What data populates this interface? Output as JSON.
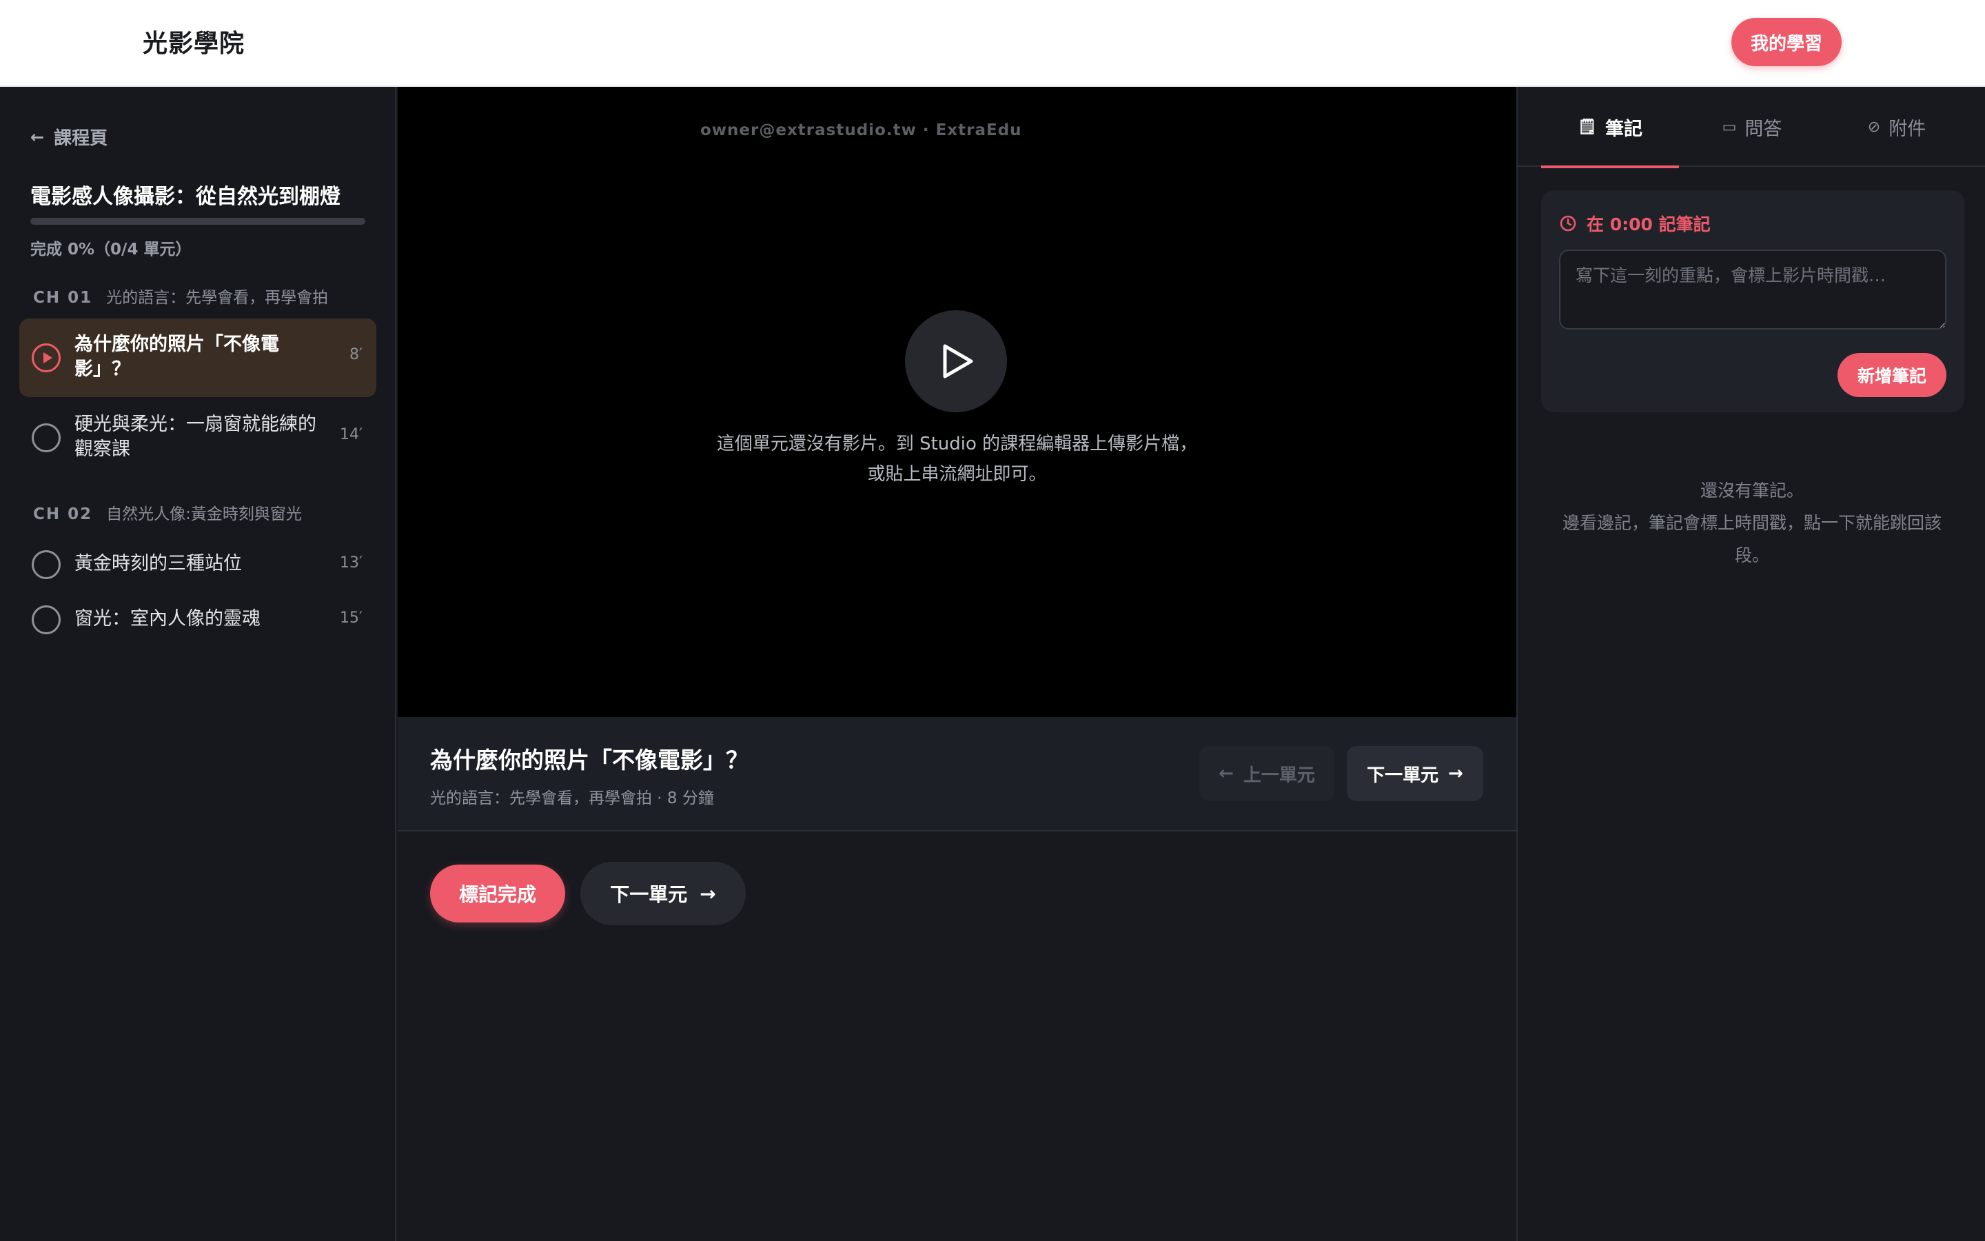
{
  "header": {
    "brand": "光影學院",
    "my_learning": "我的學習",
    "accent_color": "#ef5a6b"
  },
  "sidebar": {
    "back_label": "課程頁",
    "back_icon": "arrow-left-icon",
    "course_title": "電影感人像攝影：從自然光到棚燈",
    "progress_text": "完成 0%（0/4 單元）",
    "progress_fraction": 0,
    "chapters": [
      {
        "number": "CH 01",
        "title": "光的語言：先學會看，再學會拍",
        "lessons": [
          {
            "title": "為什麼你的照片「不像電影」？",
            "duration": "8′",
            "active": true
          },
          {
            "title": "硬光與柔光：一扇窗就能練的觀察課",
            "duration": "14′",
            "active": false
          }
        ]
      },
      {
        "number": "CH 02",
        "title": "自然光人像:黃金時刻與窗光",
        "lessons": [
          {
            "title": "黃金時刻的三種站位",
            "duration": "13′",
            "active": false
          },
          {
            "title": "窗光：室內人像的靈魂",
            "duration": "15′",
            "active": false
          }
        ]
      }
    ]
  },
  "video": {
    "watermark": "owner@extrastudio.tw · ExtraEdu",
    "play_icon": "play-icon",
    "empty_line1": "這個單元還沒有影片。到 Studio 的課程編輯器上傳影片檔，",
    "empty_line2": "或貼上串流網址即可。"
  },
  "lesson": {
    "title": "為什麼你的照片「不像電影」？",
    "meta": "光的語言：先學會看，再學會拍 · 8 分鐘",
    "prev_label": "上一單元",
    "next_label": "下一單元",
    "mark_done": "標記完成",
    "next_pill": "下一單元"
  },
  "notes_panel": {
    "tabs": [
      {
        "label": "筆記",
        "icon": "note-icon",
        "active": true
      },
      {
        "label": "問答",
        "icon": "chat-bubble-icon",
        "active": false
      },
      {
        "label": "附件",
        "icon": "paperclip-icon",
        "active": false
      }
    ],
    "timestamp_label": "在 0:00 記筆記",
    "timestamp_icon": "clock-icon",
    "placeholder": "寫下這一刻的重點，會標上影片時間戳…",
    "add_button": "新增筆記",
    "empty_line1": "還沒有筆記。",
    "empty_line2": "邊看邊記，筆記會標上時間戳，點一下就能跳回該",
    "empty_line3": "段。"
  }
}
